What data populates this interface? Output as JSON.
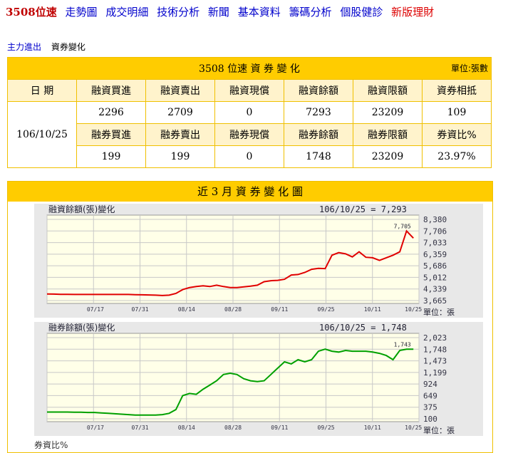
{
  "nav": {
    "stock": "3508位速",
    "links": [
      "走勢圖",
      "成交明細",
      "技術分析",
      "新聞",
      "基本資料",
      "籌碼分析",
      "個股健診"
    ],
    "new_link": "新版理財"
  },
  "subnav": {
    "link": "主力進出",
    "current": "資券變化"
  },
  "table": {
    "title": "3508 位速 資 券 變 化",
    "unit": "單位:張數",
    "date_header": "日 期",
    "date": "106/10/25",
    "margin_headers": [
      "融資買進",
      "融資賣出",
      "融資現償",
      "融資餘額",
      "融資限額",
      "資券相抵"
    ],
    "margin_values": [
      "2296",
      "2709",
      "0",
      "7293",
      "23209",
      "109"
    ],
    "short_headers": [
      "融券買進",
      "融券賣出",
      "融券現償",
      "融券餘額",
      "融券限額",
      "券資比%"
    ],
    "short_values": [
      "199",
      "199",
      "0",
      "1748",
      "23209",
      "23.97%"
    ]
  },
  "panel_title": "近 3 月 資 券 變 化 圖",
  "charts": [
    {
      "title": "融資餘額(張)變化",
      "latest_label": "106/10/25 = 7,293",
      "last_value_label": "7,705",
      "unit_label": "單位：張",
      "color": "#e00000",
      "yticks": [
        "8,380",
        "7,706",
        "7,033",
        "6,359",
        "5,686",
        "5,012",
        "4,339",
        "3,665"
      ],
      "ylim": [
        3665,
        8380
      ],
      "xticks": [
        "07/17",
        "07/31",
        "08/14",
        "08/28",
        "09/11",
        "09/25",
        "10/11",
        "10/25"
      ],
      "values": [
        4050,
        4040,
        4030,
        4030,
        4020,
        4020,
        4020,
        4020,
        4020,
        4020,
        4020,
        4020,
        4020,
        4010,
        4000,
        3990,
        3980,
        3960,
        3980,
        4080,
        4300,
        4420,
        4480,
        4520,
        4480,
        4560,
        4480,
        4420,
        4420,
        4460,
        4500,
        4560,
        4760,
        4820,
        4840,
        4900,
        5150,
        5180,
        5300,
        5480,
        5540,
        5520,
        6300,
        6450,
        6380,
        6200,
        6500,
        6180,
        6150,
        6000,
        6150,
        6300,
        6500,
        7705,
        7293
      ],
      "x_positions_note": ""
    },
    {
      "title": "融券餘額(張)變化",
      "latest_label": "106/10/25 = 1,748",
      "last_value_label": "1,743",
      "unit_label": "單位：張",
      "color": "#00a000",
      "yticks": [
        "2,023",
        "1,748",
        "1,473",
        "1,199",
        "924",
        "649",
        "375",
        "100"
      ],
      "ylim": [
        100,
        2023
      ],
      "xticks": [
        "07/17",
        "07/31",
        "08/14",
        "08/28",
        "09/11",
        "09/25",
        "10/11",
        "10/25"
      ],
      "values": [
        260,
        260,
        260,
        260,
        255,
        255,
        250,
        250,
        240,
        230,
        220,
        210,
        200,
        190,
        190,
        190,
        190,
        200,
        230,
        320,
        650,
        700,
        680,
        800,
        900,
        1000,
        1150,
        1180,
        1150,
        1050,
        1000,
        980,
        1000,
        1150,
        1300,
        1450,
        1400,
        1500,
        1450,
        1500,
        1700,
        1750,
        1700,
        1680,
        1720,
        1700,
        1700,
        1700,
        1680,
        1650,
        1600,
        1500,
        1720,
        1748,
        1748
      ]
    }
  ],
  "third_chart_title": "券資比%"
}
